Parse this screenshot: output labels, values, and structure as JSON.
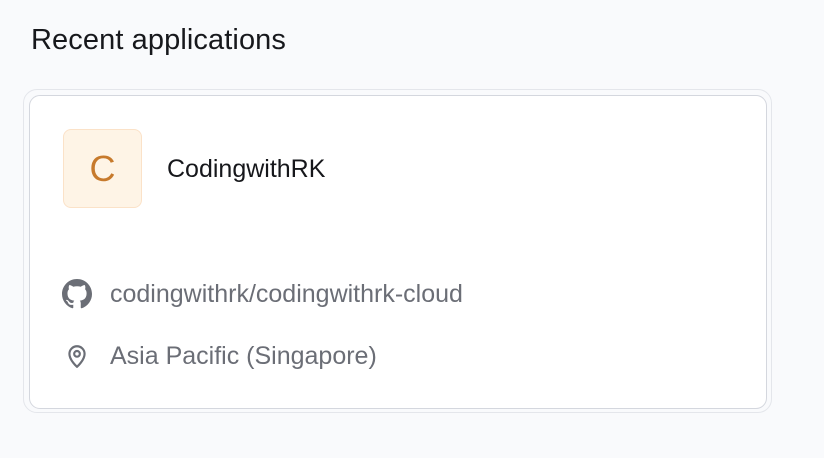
{
  "section": {
    "title": "Recent applications"
  },
  "applications": [
    {
      "avatar_letter": "C",
      "name": "CodingwithRK",
      "repository": "codingwithrk/codingwithrk-cloud",
      "region": "Asia Pacific (Singapore)",
      "repo_icon": "github-icon",
      "region_icon": "map-pin-icon"
    }
  ],
  "colors": {
    "avatar_bg": "#fef4e6",
    "avatar_text": "#c77a2c",
    "muted_text": "#6b6e76"
  }
}
